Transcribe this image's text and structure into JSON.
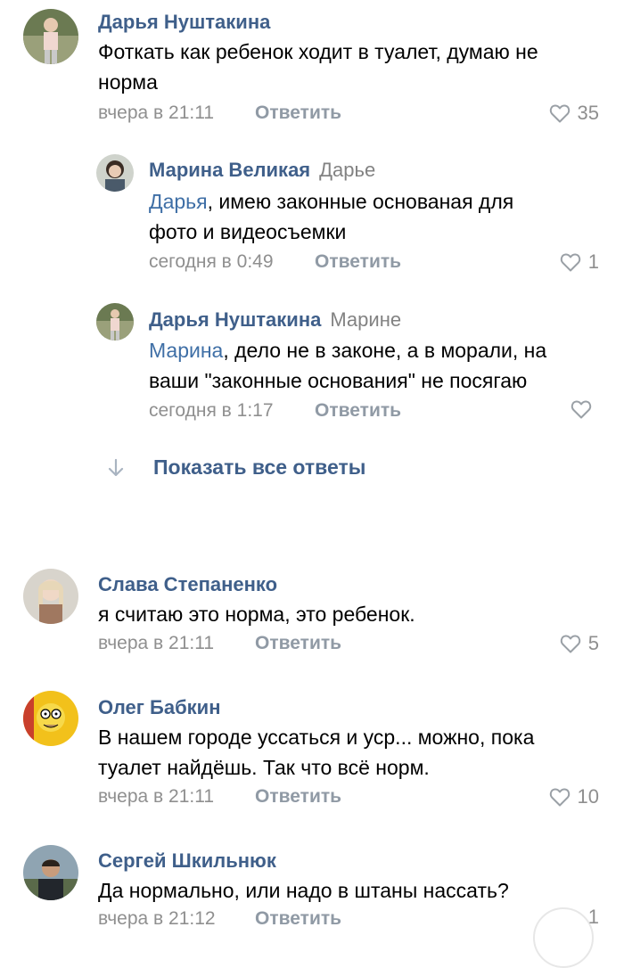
{
  "comments": [
    {
      "author": "Дарья Нуштакина",
      "text_line1": "Фоткать как ребенок ходит в туалет, думаю не",
      "text_line2": "норма",
      "time": "вчера в 21:11",
      "reply_label": "Ответить",
      "likes": "35"
    },
    {
      "author": "Марина Великая",
      "reply_to": "Дарье",
      "mention": "Дарья",
      "text_line1_rest": ", имею законные основаная для",
      "text_line2": "фото и видеосъемки",
      "time": "сегодня в 0:49",
      "reply_label": "Ответить",
      "likes": "1"
    },
    {
      "author": "Дарья Нуштакина",
      "reply_to": "Марине",
      "mention": "Марина",
      "text_line1_rest": ", дело не в законе, а в морали, на",
      "text_line2": "ваши \"законные основания\" не посягаю",
      "time": "сегодня в 1:17",
      "reply_label": "Ответить",
      "likes": ""
    },
    {
      "author": "Слава Степаненко",
      "text_line1": "я считаю это норма, это ребенок.",
      "time": "вчера в 21:11",
      "reply_label": "Ответить",
      "likes": "5"
    },
    {
      "author": "Олег Бабкин",
      "text_line1": "В нашем городе уссаться и уср... можно, пока",
      "text_line2": "туалет найдёшь. Так что всё норм.",
      "time": "вчера в 21:11",
      "reply_label": "Ответить",
      "likes": "10"
    },
    {
      "author": "Сергей Шкильнюк",
      "text_line1": "Да нормально, или надо в штаны нассать?",
      "time": "вчера в 21:12",
      "reply_label": "Ответить",
      "likes": "1"
    }
  ],
  "show_all_replies": "Показать все ответы",
  "colors": {
    "author": "#3f5f8a",
    "mention": "#3f6fa6",
    "meta": "#8f8f8f"
  },
  "icons": {
    "like": "heart-outline-icon",
    "show_all": "arrow-down-icon"
  }
}
